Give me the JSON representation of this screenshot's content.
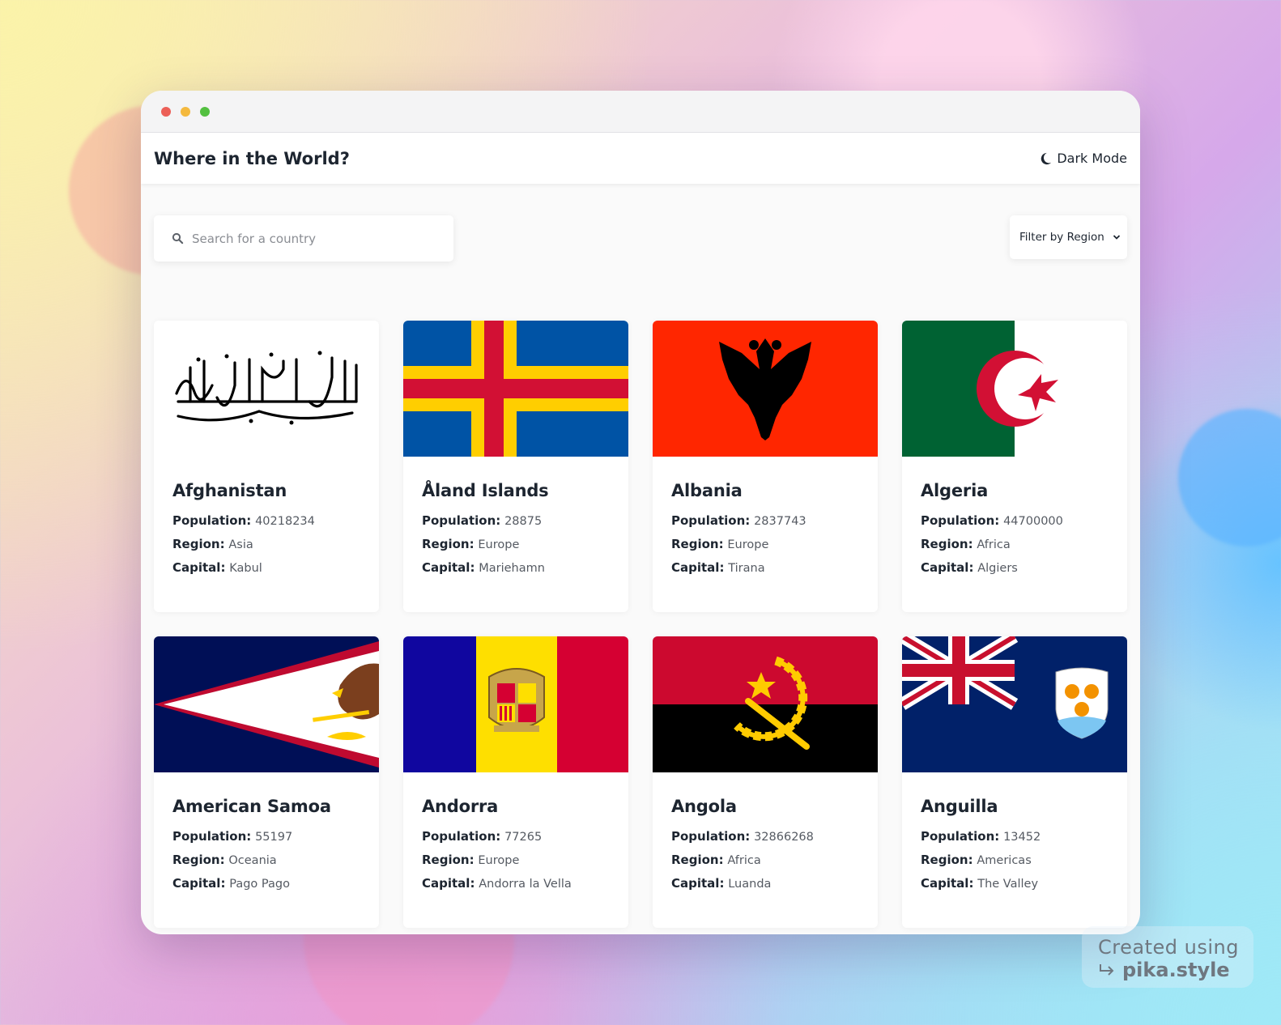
{
  "window": {
    "dots": [
      "#ec5f57",
      "#f4b93e",
      "#53c040"
    ]
  },
  "header": {
    "title": "Where in the World?",
    "dark_mode_label": "Dark Mode",
    "dark_mode_icon": "moon-icon"
  },
  "search": {
    "placeholder": "Search for a country",
    "icon": "search-icon"
  },
  "filter": {
    "label": "Filter by Region",
    "icon": "chevron-down-icon"
  },
  "labels": {
    "population": "Population:",
    "region": "Region:",
    "capital": "Capital:"
  },
  "countries": [
    {
      "name": "Afghanistan",
      "population": "40218234",
      "region": "Asia",
      "capital": "Kabul"
    },
    {
      "name": "Åland Islands",
      "population": "28875",
      "region": "Europe",
      "capital": "Mariehamn"
    },
    {
      "name": "Albania",
      "population": "2837743",
      "region": "Europe",
      "capital": "Tirana"
    },
    {
      "name": "Algeria",
      "population": "44700000",
      "region": "Africa",
      "capital": "Algiers"
    },
    {
      "name": "American Samoa",
      "population": "55197",
      "region": "Oceania",
      "capital": "Pago Pago"
    },
    {
      "name": "Andorra",
      "population": "77265",
      "region": "Europe",
      "capital": "Andorra la Vella"
    },
    {
      "name": "Angola",
      "population": "32866268",
      "region": "Africa",
      "capital": "Luanda"
    },
    {
      "name": "Anguilla",
      "population": "13452",
      "region": "Americas",
      "capital": "The Valley"
    }
  ],
  "watermark": {
    "line1": "Created using",
    "line2": "pika.style"
  }
}
